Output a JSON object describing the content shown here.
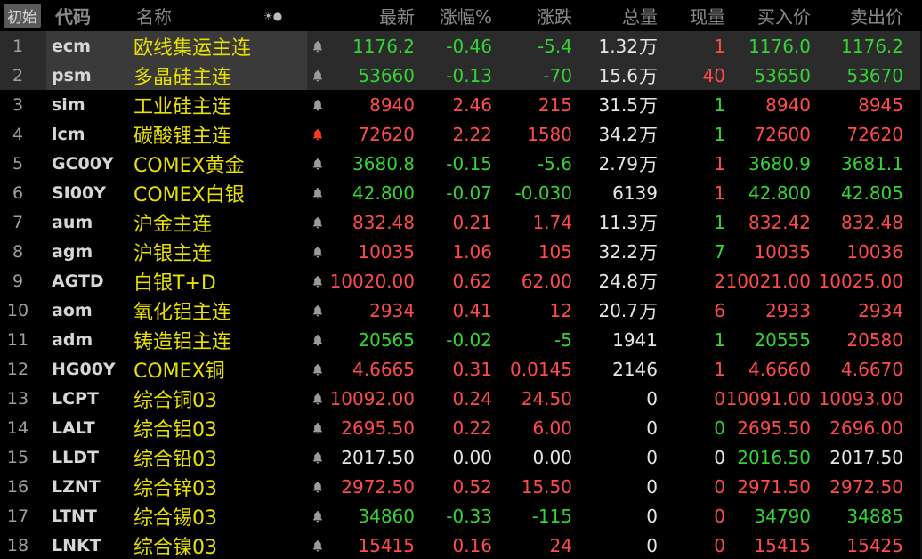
{
  "colors": {
    "up": "#ff4b4b",
    "down": "#33d433",
    "flat": "#e6e6e6",
    "name": "#e8e000",
    "bell_normal": "#9a9a9a",
    "bell_alert": "#ff3b1f"
  },
  "header": {
    "reset_button": "初始",
    "code": "代码",
    "name": "名称",
    "icons": "☀●",
    "last": "最新",
    "pct": "涨幅%",
    "change": "涨跌",
    "volume": "总量",
    "current": "现量",
    "bid": "买入价",
    "ask": "卖出价"
  },
  "rows": [
    {
      "index": "1",
      "code": "ecm",
      "name": "欧线集运主连",
      "bell": "normal",
      "last": "1176.2",
      "pct": "-0.46",
      "change": "-5.4",
      "volume": "1.32",
      "unit": "万",
      "current": "1",
      "bid": "1176.0",
      "ask": "1176.2",
      "c_last": "down",
      "c_pct": "down",
      "c_chg": "down",
      "c_cur": "up",
      "c_bid": "down",
      "c_ask": "down",
      "selected": true
    },
    {
      "index": "2",
      "code": "psm",
      "name": "多晶硅主连",
      "bell": "normal",
      "last": "53660",
      "pct": "-0.13",
      "change": "-70",
      "volume": "15.6",
      "unit": "万",
      "current": "40",
      "bid": "53650",
      "ask": "53670",
      "c_last": "down",
      "c_pct": "down",
      "c_chg": "down",
      "c_cur": "up",
      "c_bid": "down",
      "c_ask": "down",
      "selected": true
    },
    {
      "index": "3",
      "code": "sim",
      "name": "工业硅主连",
      "bell": "normal",
      "last": "8940",
      "pct": "2.46",
      "change": "215",
      "volume": "31.5",
      "unit": "万",
      "current": "1",
      "bid": "8940",
      "ask": "8945",
      "c_last": "up",
      "c_pct": "up",
      "c_chg": "up",
      "c_cur": "down",
      "c_bid": "up",
      "c_ask": "up"
    },
    {
      "index": "4",
      "code": "lcm",
      "name": "碳酸锂主连",
      "bell": "alert",
      "last": "72620",
      "pct": "2.22",
      "change": "1580",
      "volume": "34.2",
      "unit": "万",
      "current": "1",
      "bid": "72600",
      "ask": "72620",
      "c_last": "up",
      "c_pct": "up",
      "c_chg": "up",
      "c_cur": "down",
      "c_bid": "up",
      "c_ask": "up"
    },
    {
      "index": "5",
      "code": "GC00Y",
      "name": "COMEX黄金",
      "bell": "normal",
      "last": "3680.8",
      "pct": "-0.15",
      "change": "-5.6",
      "volume": "2.79",
      "unit": "万",
      "current": "1",
      "bid": "3680.9",
      "ask": "3681.1",
      "c_last": "down",
      "c_pct": "down",
      "c_chg": "down",
      "c_cur": "up",
      "c_bid": "down",
      "c_ask": "down"
    },
    {
      "index": "6",
      "code": "SI00Y",
      "name": "COMEX白银",
      "bell": "normal",
      "last": "42.800",
      "pct": "-0.07",
      "change": "-0.030",
      "volume": "6139",
      "unit": "",
      "current": "1",
      "bid": "42.800",
      "ask": "42.805",
      "c_last": "down",
      "c_pct": "down",
      "c_chg": "down",
      "c_cur": "up",
      "c_bid": "down",
      "c_ask": "down"
    },
    {
      "index": "7",
      "code": "aum",
      "name": "沪金主连",
      "bell": "normal",
      "last": "832.48",
      "pct": "0.21",
      "change": "1.74",
      "volume": "11.3",
      "unit": "万",
      "current": "1",
      "bid": "832.42",
      "ask": "832.48",
      "c_last": "up",
      "c_pct": "up",
      "c_chg": "up",
      "c_cur": "down",
      "c_bid": "up",
      "c_ask": "up"
    },
    {
      "index": "8",
      "code": "agm",
      "name": "沪银主连",
      "bell": "normal",
      "last": "10035",
      "pct": "1.06",
      "change": "105",
      "volume": "32.2",
      "unit": "万",
      "current": "7",
      "bid": "10035",
      "ask": "10036",
      "c_last": "up",
      "c_pct": "up",
      "c_chg": "up",
      "c_cur": "down",
      "c_bid": "up",
      "c_ask": "up"
    },
    {
      "index": "9",
      "code": "AGTD",
      "name": "白银T+D",
      "bell": "normal",
      "last": "10020.00",
      "pct": "0.62",
      "change": "62.00",
      "volume": "24.8",
      "unit": "万",
      "current": "2",
      "bid": "10021.00",
      "ask": "10025.00",
      "c_last": "up",
      "c_pct": "up",
      "c_chg": "up",
      "c_cur": "up",
      "c_bid": "up",
      "c_ask": "up"
    },
    {
      "index": "10",
      "code": "aom",
      "name": "氧化铝主连",
      "bell": "normal",
      "last": "2934",
      "pct": "0.41",
      "change": "12",
      "volume": "20.7",
      "unit": "万",
      "current": "6",
      "bid": "2933",
      "ask": "2934",
      "c_last": "up",
      "c_pct": "up",
      "c_chg": "up",
      "c_cur": "up",
      "c_bid": "up",
      "c_ask": "up"
    },
    {
      "index": "11",
      "code": "adm",
      "name": "铸造铝主连",
      "bell": "normal",
      "last": "20565",
      "pct": "-0.02",
      "change": "-5",
      "volume": "1941",
      "unit": "",
      "current": "1",
      "bid": "20555",
      "ask": "20580",
      "c_last": "down",
      "c_pct": "down",
      "c_chg": "down",
      "c_cur": "down",
      "c_bid": "down",
      "c_ask": "up"
    },
    {
      "index": "12",
      "code": "HG00Y",
      "name": "COMEX铜",
      "bell": "normal",
      "last": "4.6665",
      "pct": "0.31",
      "change": "0.0145",
      "volume": "2146",
      "unit": "",
      "current": "1",
      "bid": "4.6660",
      "ask": "4.6670",
      "c_last": "up",
      "c_pct": "up",
      "c_chg": "up",
      "c_cur": "up",
      "c_bid": "up",
      "c_ask": "up"
    },
    {
      "index": "13",
      "code": "LCPT",
      "name": "综合铜03",
      "bell": "normal",
      "last": "10092.00",
      "pct": "0.24",
      "change": "24.50",
      "volume": "0",
      "unit": "",
      "current": "0",
      "bid": "10091.00",
      "ask": "10093.00",
      "c_last": "up",
      "c_pct": "up",
      "c_chg": "up",
      "c_cur": "up",
      "c_bid": "up",
      "c_ask": "up"
    },
    {
      "index": "14",
      "code": "LALT",
      "name": "综合铝03",
      "bell": "normal",
      "last": "2695.50",
      "pct": "0.22",
      "change": "6.00",
      "volume": "0",
      "unit": "",
      "current": "0",
      "bid": "2695.50",
      "ask": "2696.00",
      "c_last": "up",
      "c_pct": "up",
      "c_chg": "up",
      "c_cur": "down",
      "c_bid": "up",
      "c_ask": "up"
    },
    {
      "index": "15",
      "code": "LLDT",
      "name": "综合铅03",
      "bell": "normal",
      "last": "2017.50",
      "pct": "0.00",
      "change": "0.00",
      "volume": "0",
      "unit": "",
      "current": "0",
      "bid": "2016.50",
      "ask": "2017.50",
      "c_last": "flat",
      "c_pct": "flat",
      "c_chg": "flat",
      "c_cur": "flat",
      "c_bid": "down",
      "c_ask": "flat"
    },
    {
      "index": "16",
      "code": "LZNT",
      "name": "综合锌03",
      "bell": "normal",
      "last": "2972.50",
      "pct": "0.52",
      "change": "15.50",
      "volume": "0",
      "unit": "",
      "current": "0",
      "bid": "2971.50",
      "ask": "2972.50",
      "c_last": "up",
      "c_pct": "up",
      "c_chg": "up",
      "c_cur": "up",
      "c_bid": "up",
      "c_ask": "up"
    },
    {
      "index": "17",
      "code": "LTNT",
      "name": "综合锡03",
      "bell": "normal",
      "last": "34860",
      "pct": "-0.33",
      "change": "-115",
      "volume": "0",
      "unit": "",
      "current": "0",
      "bid": "34790",
      "ask": "34885",
      "c_last": "down",
      "c_pct": "down",
      "c_chg": "down",
      "c_cur": "up",
      "c_bid": "down",
      "c_ask": "down"
    },
    {
      "index": "18",
      "code": "LNKT",
      "name": "综合镍03",
      "bell": "normal",
      "last": "15415",
      "pct": "0.16",
      "change": "24",
      "volume": "0",
      "unit": "",
      "current": "0",
      "bid": "15415",
      "ask": "15425",
      "c_last": "up",
      "c_pct": "up",
      "c_chg": "up",
      "c_cur": "up",
      "c_bid": "up",
      "c_ask": "up"
    }
  ]
}
